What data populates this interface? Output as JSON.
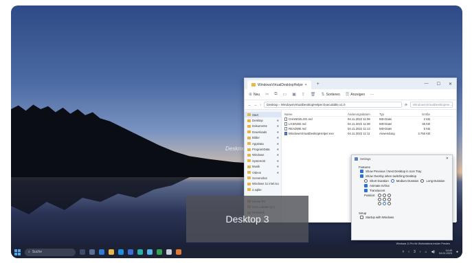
{
  "watermark": "Deskmodder.de",
  "explorer": {
    "tab_title": "WindowsVirtualDesktopHelpe",
    "toolbar": {
      "new_label": "Neu",
      "sort_label": "Sortieren",
      "view_label": "Anzeigen",
      "more_label": "···"
    },
    "address": {
      "path": "Desktop › WindowsVirtualDesktopHelper.Executable.v1.0",
      "search_placeholder": "WindowsVirtualDesktopHe..."
    },
    "nav_items": [
      {
        "label": "Start",
        "active": true
      },
      {
        "label": "Desktop",
        "pinned": true
      },
      {
        "label": "Dokumente",
        "pinned": true
      },
      {
        "label": "Downloads",
        "pinned": true
      },
      {
        "label": "Bilder",
        "pinned": true
      },
      {
        "label": "AppData",
        "pinned": true
      },
      {
        "label": "ProgramData",
        "pinned": true
      },
      {
        "label": "Windows",
        "pinned": true
      },
      {
        "label": "System32",
        "pinned": true
      },
      {
        "label": "Musik",
        "pinned": true
      },
      {
        "label": "Videos",
        "pinned": true
      },
      {
        "label": "Screenshot",
        "pinned": false
      },
      {
        "label": "Windows 11 intel.iso",
        "pinned": false
      },
      {
        "label": "2.sqlite",
        "pinned": false
      },
      {
        "label": "",
        "pinned": false
      },
      {
        "label": "Dieser PC",
        "pinned": false
      },
      {
        "label": "NVD Lokaler (C:)",
        "pinned": false
      },
      {
        "label": "Netzwerk",
        "pinned": false
      }
    ],
    "columns": [
      "Name",
      "Änderungsdatum",
      "Typ",
      "Größe"
    ],
    "files": [
      {
        "name": "CHANGELOG.md",
        "date": "04.11.2022 11:08",
        "type": "MD-Datei",
        "size": "2 KB",
        "exe": false
      },
      {
        "name": "LICENSE.md",
        "date": "04.11.2022 11:08",
        "type": "MD-Datei",
        "size": "35 KB",
        "exe": false
      },
      {
        "name": "README.md",
        "date": "04.11.2022 11:13",
        "type": "MD-Datei",
        "size": "5 KB",
        "exe": false
      },
      {
        "name": "WindowsVirtualDesktopHelper.exe",
        "date": "04.11.2022 11:11",
        "type": "Anwendung",
        "size": "3.756 KB",
        "exe": true
      }
    ]
  },
  "settings": {
    "title": "Settings",
    "features_label": "Features",
    "show_prev_next": "Show Previous / Next Desktop in Icon Tray",
    "show_overlay": "Show Overlay when switching Desktop",
    "duration_short": "Short Duration",
    "duration_medium": "Medium Duration",
    "duration_long": "Long Duration",
    "animate": "Animate In/Out",
    "translucent": "Translucent",
    "position_label": "Position:",
    "setup_label": "Setup",
    "startup": "Startup with Windows"
  },
  "overlay": {
    "text": "Desktop 3"
  },
  "os_watermark": {
    "line1": "Windows 11 Pro für Workstations Insider Preview",
    "line2": "Evaluierungskopie. Build 25247.rs_prerelease.221209-1347"
  },
  "taskbar": {
    "search_placeholder": "Suche",
    "time": "14:49",
    "date": "04.01.2023",
    "tray_desktop": "3"
  },
  "colors": {
    "accent": "#2f6ed6",
    "taskbar": "#1c2233"
  }
}
